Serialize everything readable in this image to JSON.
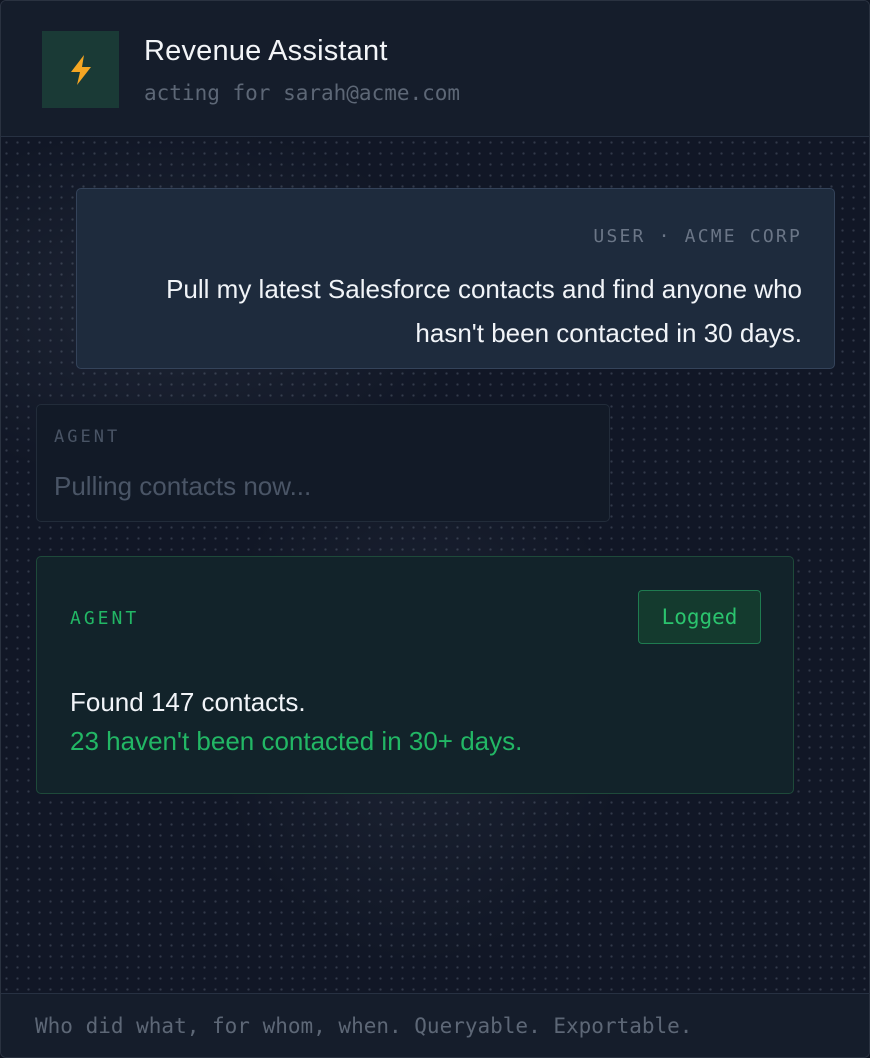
{
  "header": {
    "title": "Revenue Assistant",
    "subtitle": "acting for sarah@acme.com",
    "icon": "lightning-bolt-icon",
    "icon_color": "#f5a623"
  },
  "messages": {
    "user": {
      "meta": "USER · ACME CORP",
      "text": "Pull my latest Salesforce contacts and find anyone who hasn't been contacted in 30 days."
    },
    "agent_pending": {
      "label": "AGENT",
      "text": "Pulling contacts now..."
    },
    "agent_result": {
      "label": "AGENT",
      "badge": "Logged",
      "line1": "Found 147 contacts.",
      "line2": "23 haven't been contacted in 30+ days."
    }
  },
  "footer": {
    "text": "Who did what, for whom, when. Queryable. Exportable."
  },
  "colors": {
    "accent_green": "#22b765",
    "background": "#111827"
  }
}
